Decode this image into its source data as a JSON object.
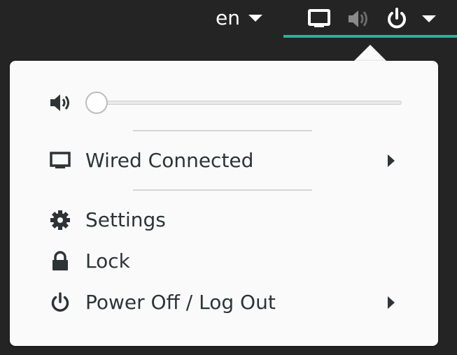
{
  "topbar": {
    "language": "en",
    "icons": [
      "network-wired-icon",
      "volume-muted-icon",
      "power-icon"
    ],
    "accent_color": "#2ab29a"
  },
  "menu": {
    "volume": {
      "icon": "speaker-icon",
      "level": 0.0
    },
    "items": [
      {
        "icon": "network-wired-icon",
        "label": "Wired Connected",
        "has_submenu": true
      },
      {
        "icon": "gear-icon",
        "label": "Settings",
        "has_submenu": false
      },
      {
        "icon": "lock-icon",
        "label": "Lock",
        "has_submenu": false
      },
      {
        "icon": "power-icon",
        "label": "Power Off / Log Out",
        "has_submenu": true
      }
    ]
  }
}
